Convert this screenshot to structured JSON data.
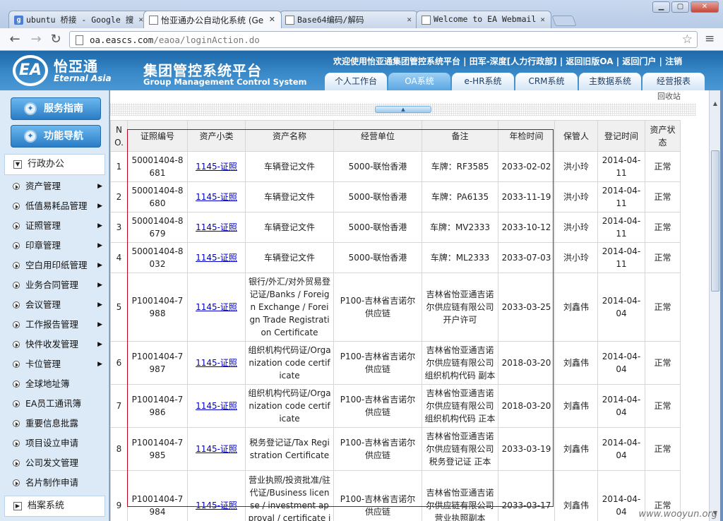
{
  "browser": {
    "tabs": [
      {
        "title": "ubuntu 桥接 - Google 搜",
        "icon": "google-icon"
      },
      {
        "title": "怡亚通办公自动化系统 (Ge",
        "icon": "page-icon"
      },
      {
        "title": "Base64编码/解码",
        "icon": "page-icon"
      },
      {
        "title": "Welcome to EA Webmail",
        "icon": "page-icon"
      }
    ],
    "url_host": "oa.eascs.com",
    "url_path": "/eaoa/loginAction.do"
  },
  "header": {
    "logo_cn": "怡亞通",
    "logo_en": "Eternal Asia",
    "logo_mark": "EA",
    "system_title": "集团管控系统平台",
    "system_subtitle": "Group Management Control System",
    "top_links": "欢迎使用怡亚通集团管控系统平台 | 田军-深度[人力行政部] | 返回旧版OA | 返回门户 | 注销",
    "nav_tabs": [
      "个人工作台",
      "OA系统",
      "e-HR系统",
      "CRM系统",
      "主数据系统",
      "经营报表"
    ],
    "active_tab": "OA系统"
  },
  "sidebar": {
    "service_guide": "服务指南",
    "func_nav": "功能导航",
    "section_admin": "行政办公",
    "items": [
      {
        "label": "资产管理",
        "has_sub": true
      },
      {
        "label": "低值易耗品管理",
        "has_sub": true
      },
      {
        "label": "证照管理",
        "has_sub": true
      },
      {
        "label": "印章管理",
        "has_sub": true
      },
      {
        "label": "空白用印纸管理",
        "has_sub": true
      },
      {
        "label": "业务合同管理",
        "has_sub": true
      },
      {
        "label": "会议管理",
        "has_sub": true
      },
      {
        "label": "工作报告管理",
        "has_sub": true
      },
      {
        "label": "快件收发管理",
        "has_sub": true
      },
      {
        "label": "卡位管理",
        "has_sub": true
      },
      {
        "label": "全球地址簿",
        "has_sub": false
      },
      {
        "label": "EA员工通讯簿",
        "has_sub": false
      },
      {
        "label": "重要信息批露",
        "has_sub": false
      },
      {
        "label": "项目设立申请",
        "has_sub": false
      },
      {
        "label": "公司发文管理",
        "has_sub": false
      },
      {
        "label": "名片制作申请",
        "has_sub": false
      }
    ],
    "section_archive": "档案系统"
  },
  "main": {
    "top_hint": "回收站",
    "table": {
      "headers": [
        "NO.",
        "证照编号",
        "资产小类",
        "资产名称",
        "经营单位",
        "备注",
        "年检时间",
        "保管人",
        "登记时间",
        "资产状态"
      ],
      "rows": [
        [
          "1",
          "50001404-8681",
          "1145-证照",
          "车辆登记文件",
          "5000-联怡香港",
          "车牌：RF3585",
          "2033-02-02",
          "洪小玲",
          "2014-04-11",
          "正常"
        ],
        [
          "2",
          "50001404-8680",
          "1145-证照",
          "车辆登记文件",
          "5000-联怡香港",
          "车牌：PA6135",
          "2033-11-19",
          "洪小玲",
          "2014-04-11",
          "正常"
        ],
        [
          "3",
          "50001404-8679",
          "1145-证照",
          "车辆登记文件",
          "5000-联怡香港",
          "车牌：MV2333",
          "2033-10-12",
          "洪小玲",
          "2014-04-11",
          "正常"
        ],
        [
          "4",
          "50001404-8032",
          "1145-证照",
          "车辆登记文件",
          "5000-联怡香港",
          "车牌：ML2333",
          "2033-07-03",
          "洪小玲",
          "2014-04-11",
          "正常"
        ],
        [
          "5",
          "P1001404-7988",
          "1145-证照",
          "银行/外汇/对外贸易登记证/Banks / Foreign Exchange / Foreign Trade Registration Certificate",
          "P100-吉林省吉诺尔供应链",
          "吉林省怡亚通吉诺尔供应链有限公司开户许可",
          "2033-03-25",
          "刘鑫伟",
          "2014-04-04",
          "正常"
        ],
        [
          "6",
          "P1001404-7987",
          "1145-证照",
          "组织机构代码证/Organization code certificate",
          "P100-吉林省吉诺尔供应链",
          "吉林省怡亚通吉诺尔供应链有限公司组织机构代码 副本",
          "2018-03-20",
          "刘鑫伟",
          "2014-04-04",
          "正常"
        ],
        [
          "7",
          "P1001404-7986",
          "1145-证照",
          "组织机构代码证/Organization code certificate",
          "P100-吉林省吉诺尔供应链",
          "吉林省怡亚通吉诺尔供应链有限公司组织机构代码 正本",
          "2018-03-20",
          "刘鑫伟",
          "2014-04-04",
          "正常"
        ],
        [
          "8",
          "P1001404-7985",
          "1145-证照",
          "税务登记证/Tax Registration Certificate",
          "P100-吉林省吉诺尔供应链",
          "吉林省怡亚通吉诺尔供应链有限公司税务登记证 正本",
          "2033-03-19",
          "刘鑫伟",
          "2014-04-04",
          "正常"
        ],
        [
          "9",
          "P1001404-7984",
          "1145-证照",
          "营业执照/投资批准/驻代证/Business license / investment approval / certificate in behalf",
          "P100-吉林省吉诺尔供应链",
          "吉林省怡亚通吉诺尔供应链有限公司营业执照副本",
          "2033-03-17",
          "刘鑫伟",
          "2014-04-04",
          "正常"
        ]
      ]
    }
  },
  "watermark": "www.wooyun.org"
}
